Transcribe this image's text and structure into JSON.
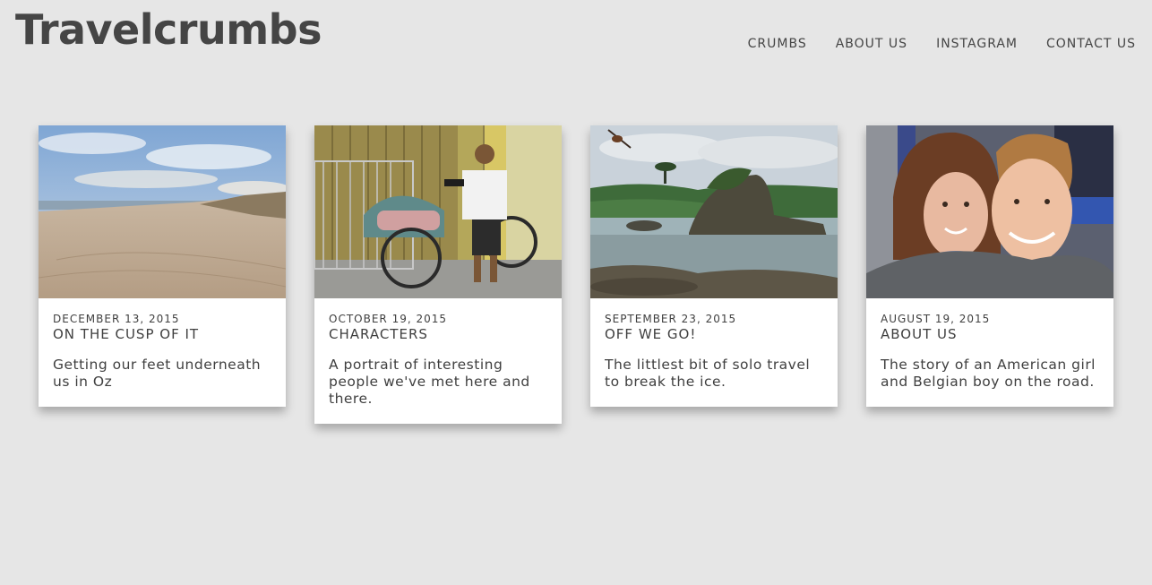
{
  "site": {
    "title": "Travelcrumbs"
  },
  "nav": [
    {
      "label": "CRUMBS"
    },
    {
      "label": "ABOUT US"
    },
    {
      "label": "INSTAGRAM"
    },
    {
      "label": "CONTACT US"
    }
  ],
  "posts": [
    {
      "date": "DECEMBER 13, 2015",
      "title": "ON THE CUSP OF IT",
      "excerpt": "Getting our feet underneath us in Oz",
      "image": "beach-photo"
    },
    {
      "date": "OCTOBER 19, 2015",
      "title": "CHARACTERS",
      "excerpt": "A portrait of interesting people we've met here and there.",
      "image": "rickshaw-man-photo"
    },
    {
      "date": "SEPTEMBER 23, 2015",
      "title": "OFF WE GO!",
      "excerpt": "The littlest bit of solo travel to break the ice.",
      "image": "rocky-shore-photo"
    },
    {
      "date": "AUGUST 19, 2015",
      "title": "ABOUT US",
      "excerpt": "The story of an American girl and Belgian boy on the road.",
      "image": "couple-selfie-photo"
    }
  ]
}
